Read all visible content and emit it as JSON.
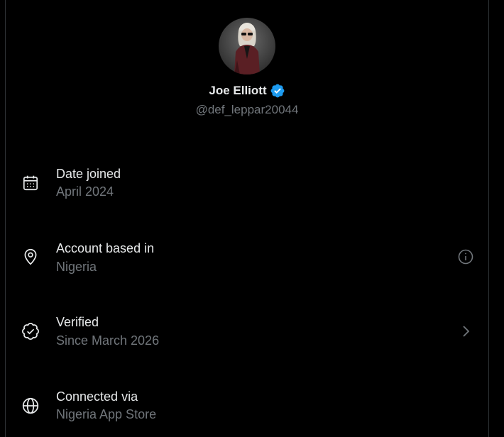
{
  "profile": {
    "display_name": "Joe Elliott",
    "handle": "@def_leppar20044",
    "verified": true
  },
  "colors": {
    "background": "#000000",
    "primary_text": "#e7e9ea",
    "secondary_text": "#71767b",
    "verified_blue": "#1d9bf0",
    "border": "#2f3336"
  },
  "rows": [
    {
      "icon": "calendar-icon",
      "title": "Date joined",
      "value": "April 2024"
    },
    {
      "icon": "location-pin-icon",
      "title": "Account based in",
      "value": "Nigeria",
      "action_icon": "info-icon"
    },
    {
      "icon": "verified-check-icon",
      "title": "Verified",
      "value": "Since March 2026",
      "action_icon": "chevron-right-icon"
    },
    {
      "icon": "globe-icon",
      "title": "Connected via",
      "value": "Nigeria App Store"
    }
  ]
}
